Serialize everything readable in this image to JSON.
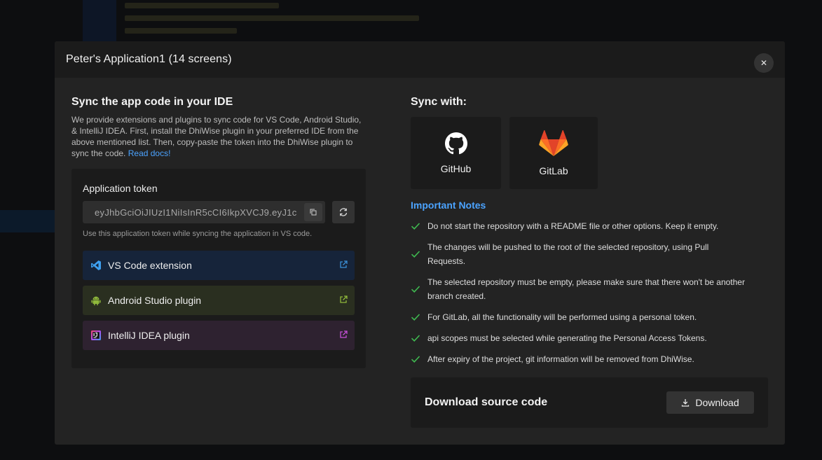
{
  "modal": {
    "title": "Peter's Application1 (14 screens)",
    "close_icon": "close-icon"
  },
  "ide": {
    "heading": "Sync the app code in your IDE",
    "description": "We provide extensions and plugins to sync code for VS Code, Android Studio, & IntelliJ IDEA. First, install the DhiWise plugin in your preferred IDE from the above mentioned list. Then, copy-paste the token into the DhiWise plugin to sync the code.",
    "read_docs": "Read docs!",
    "token_label": "Application token",
    "token_value": "eyJhbGciOiJIUzI1NiIsInR5cCI6IkpXVCJ9.eyJ1c",
    "token_hint": "Use this application token while syncing the application in VS code.",
    "plugins": [
      {
        "label": "VS Code extension",
        "icon": "vscode-icon",
        "accent": "#3b8fd6"
      },
      {
        "label": "Android Studio plugin",
        "icon": "android-icon",
        "accent": "#8fb83b"
      },
      {
        "label": "IntelliJ IDEA plugin",
        "icon": "intellij-icon",
        "accent": "#c44fd6"
      }
    ]
  },
  "sync": {
    "heading": "Sync with:",
    "providers": [
      {
        "label": "GitHub",
        "icon": "github-icon"
      },
      {
        "label": "GitLab",
        "icon": "gitlab-icon"
      }
    ]
  },
  "notes": {
    "heading": "Important Notes",
    "items": [
      "Do not start the repository with a README file or other options. Keep it empty.",
      "The changes will be pushed to the root of the selected repository, using Pull Requests.",
      "The selected repository must be empty, please make sure that there won't be another branch created.",
      "For GitLab, all the functionality will be performed using a personal token.",
      "api scopes must be selected while generating the Personal Access Tokens.",
      "After expiry of the project, git information will be removed from DhiWise."
    ]
  },
  "download": {
    "heading": "Download source code",
    "button_label": "Download"
  },
  "colors": {
    "accent_link": "#4ba3ff",
    "check_green": "#3fb950",
    "modal_bg": "#232323"
  }
}
